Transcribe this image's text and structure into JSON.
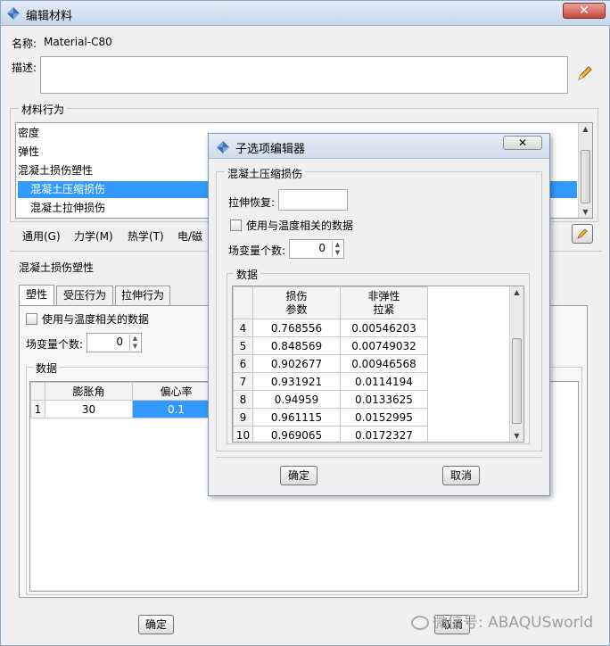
{
  "window": {
    "title": "编辑材料"
  },
  "name": {
    "label": "名称:",
    "value": "Material-C80"
  },
  "description": {
    "label": "描述:",
    "value": ""
  },
  "behaviors": {
    "group_label": "材料行为",
    "items": [
      {
        "label": "密度"
      },
      {
        "label": "弹性"
      },
      {
        "label": "混凝土损伤塑性"
      },
      {
        "label": "混凝土压缩损伤",
        "selected": true
      },
      {
        "label": "混凝土拉伸损伤"
      }
    ]
  },
  "menus": [
    "通用(G)",
    "力学(M)",
    "热学(T)",
    "电/磁"
  ],
  "cdp": {
    "section_label": "混凝土损伤塑性",
    "tabs": [
      "塑性",
      "受压行为",
      "拉伸行为"
    ],
    "temp_dependent_label": "使用与温度相关的数据",
    "field_vars_label": "场变量个数:",
    "field_vars_value": "0",
    "data_label": "数据",
    "columns": [
      "膨胀角",
      "偏心率"
    ],
    "rows": [
      {
        "num": "1",
        "values": [
          "30",
          "0.1"
        ]
      }
    ]
  },
  "bottom_buttons": {
    "ok": "确定",
    "cancel": "取消"
  },
  "sub_dialog": {
    "title": "子选项编辑器",
    "group_label": "混凝土压缩损伤",
    "recovery_label": "拉伸恢复:",
    "recovery_value": "",
    "temp_dependent_label": "使用与温度相关的数据",
    "field_vars_label": "场变量个数:",
    "field_vars_value": "0",
    "data_label": "数据",
    "columns": [
      [
        "损伤",
        "参数"
      ],
      [
        "非弹性",
        "拉紧"
      ]
    ],
    "rows": [
      {
        "num": "4",
        "damage": "0.768556",
        "inelastic": "0.00546203"
      },
      {
        "num": "5",
        "damage": "0.848569",
        "inelastic": "0.00749032"
      },
      {
        "num": "6",
        "damage": "0.902677",
        "inelastic": "0.00946568"
      },
      {
        "num": "7",
        "damage": "0.931921",
        "inelastic": "0.0114194"
      },
      {
        "num": "8",
        "damage": "0.94959",
        "inelastic": "0.0133625"
      },
      {
        "num": "9",
        "damage": "0.961115",
        "inelastic": "0.0152995"
      },
      {
        "num": "10",
        "damage": "0.969065",
        "inelastic": "0.0172327"
      }
    ],
    "ok": "确定",
    "cancel": "取消"
  },
  "watermark": "微信号: ABAQUSworld",
  "colors": {
    "selection": "#3399ff",
    "titlebar": "#c6d7ec"
  },
  "icons": [
    "app-icon",
    "close-icon",
    "pencil-icon",
    "scroll-up-icon",
    "scroll-down-icon",
    "wechat-icon"
  ]
}
